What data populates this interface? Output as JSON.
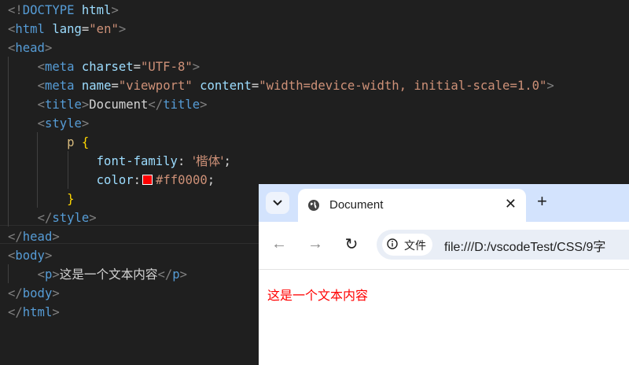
{
  "editor": {
    "lines": [
      [
        {
          "c": "p",
          "t": "<!"
        },
        {
          "c": "t",
          "t": "DOCTYPE"
        },
        {
          "c": "w",
          "t": " "
        },
        {
          "c": "a",
          "t": "html"
        },
        {
          "c": "p",
          "t": ">"
        }
      ],
      [
        {
          "c": "p",
          "t": "<"
        },
        {
          "c": "t",
          "t": "html"
        },
        {
          "c": "w",
          "t": " "
        },
        {
          "c": "a",
          "t": "lang"
        },
        {
          "c": "w",
          "t": "="
        },
        {
          "c": "s",
          "t": "\"en\""
        },
        {
          "c": "p",
          "t": ">"
        }
      ],
      [
        {
          "c": "p",
          "t": "<"
        },
        {
          "c": "t",
          "t": "head"
        },
        {
          "c": "p",
          "t": ">"
        }
      ],
      [
        {
          "c": "w",
          "t": "    "
        },
        {
          "c": "p",
          "t": "<"
        },
        {
          "c": "t",
          "t": "meta"
        },
        {
          "c": "w",
          "t": " "
        },
        {
          "c": "a",
          "t": "charset"
        },
        {
          "c": "w",
          "t": "="
        },
        {
          "c": "s",
          "t": "\"UTF-8\""
        },
        {
          "c": "p",
          "t": ">"
        }
      ],
      [
        {
          "c": "w",
          "t": "    "
        },
        {
          "c": "p",
          "t": "<"
        },
        {
          "c": "t",
          "t": "meta"
        },
        {
          "c": "w",
          "t": " "
        },
        {
          "c": "a",
          "t": "name"
        },
        {
          "c": "w",
          "t": "="
        },
        {
          "c": "s",
          "t": "\"viewport\""
        },
        {
          "c": "w",
          "t": " "
        },
        {
          "c": "a",
          "t": "content"
        },
        {
          "c": "w",
          "t": "="
        },
        {
          "c": "s",
          "t": "\"width=device-width, initial-scale=1.0\""
        },
        {
          "c": "p",
          "t": ">"
        }
      ],
      [
        {
          "c": "w",
          "t": "    "
        },
        {
          "c": "p",
          "t": "<"
        },
        {
          "c": "t",
          "t": "title"
        },
        {
          "c": "p",
          "t": ">"
        },
        {
          "c": "w",
          "t": "Document"
        },
        {
          "c": "p",
          "t": "</"
        },
        {
          "c": "t",
          "t": "title"
        },
        {
          "c": "p",
          "t": ">"
        }
      ],
      [
        {
          "c": "w",
          "t": "    "
        },
        {
          "c": "p",
          "t": "<"
        },
        {
          "c": "t",
          "t": "style"
        },
        {
          "c": "p",
          "t": ">"
        }
      ],
      [
        {
          "c": "w",
          "t": "        "
        },
        {
          "c": "sel",
          "t": "p"
        },
        {
          "c": "w",
          "t": " "
        },
        {
          "c": "br",
          "t": "{"
        }
      ],
      [
        {
          "c": "w",
          "t": "            "
        },
        {
          "c": "a",
          "t": "font-family"
        },
        {
          "c": "w",
          "t": ": "
        },
        {
          "c": "s cjk",
          "t": "'楷体'"
        },
        {
          "c": "w",
          "t": ";"
        }
      ],
      [
        {
          "c": "w",
          "t": "            "
        },
        {
          "c": "a",
          "t": "color"
        },
        {
          "c": "w",
          "t": ":"
        },
        {
          "c": "swatch",
          "t": ""
        },
        {
          "c": "s",
          "t": "#ff0000"
        },
        {
          "c": "w",
          "t": ";"
        }
      ],
      [
        {
          "c": "w",
          "t": "        "
        },
        {
          "c": "br",
          "t": "}"
        }
      ],
      [
        {
          "c": "w",
          "t": "    "
        },
        {
          "c": "p",
          "t": "</"
        },
        {
          "c": "t",
          "t": "style"
        },
        {
          "c": "p",
          "t": ">"
        }
      ],
      [
        {
          "c": "p",
          "t": "</"
        },
        {
          "c": "t",
          "t": "head"
        },
        {
          "c": "p",
          "t": ">"
        }
      ],
      [
        {
          "c": "p",
          "t": "<"
        },
        {
          "c": "t",
          "t": "body"
        },
        {
          "c": "p",
          "t": ">"
        }
      ],
      [
        {
          "c": "w",
          "t": "    "
        },
        {
          "c": "p",
          "t": "<"
        },
        {
          "c": "t",
          "t": "p"
        },
        {
          "c": "p",
          "t": ">"
        },
        {
          "c": "w cjk",
          "t": "这是一个文本内容"
        },
        {
          "c": "p",
          "t": "</"
        },
        {
          "c": "t",
          "t": "p"
        },
        {
          "c": "p",
          "t": ">"
        }
      ],
      [
        {
          "c": "p",
          "t": "</"
        },
        {
          "c": "t",
          "t": "body"
        },
        {
          "c": "p",
          "t": ">"
        }
      ],
      [
        {
          "c": "p",
          "t": "</"
        },
        {
          "c": "t",
          "t": "html"
        },
        {
          "c": "p",
          "t": ">"
        }
      ]
    ]
  },
  "browser": {
    "tab_title": "Document",
    "tab_close": "✕",
    "new_tab": "+",
    "tab_search": "⌄",
    "nav": {
      "back": "←",
      "forward": "→",
      "reload": "↻"
    },
    "security_chip_label": "文件",
    "url": "file:///D:/vscodeTest/CSS/9字",
    "content_text": "这是一个文本内容"
  }
}
